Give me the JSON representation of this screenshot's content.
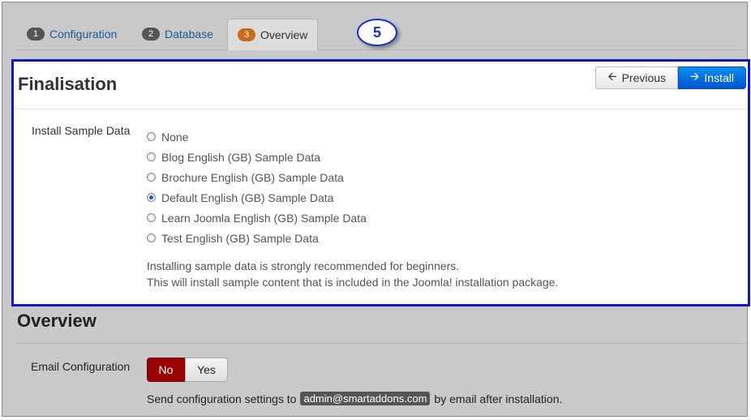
{
  "tabs": [
    {
      "num": "1",
      "label": "Configuration"
    },
    {
      "num": "2",
      "label": "Database"
    },
    {
      "num": "3",
      "label": "Overview"
    }
  ],
  "callout": "5",
  "finalisation": {
    "title": "Finalisation",
    "previous_label": "Previous",
    "install_label": "Install",
    "sample_label": "Install Sample Data",
    "options": [
      "None",
      "Blog English (GB) Sample Data",
      "Brochure English (GB) Sample Data",
      "Default English (GB) Sample Data",
      "Learn Joomla English (GB) Sample Data",
      "Test English (GB) Sample Data"
    ],
    "selected": "Default English (GB) Sample Data",
    "help_line1": "Installing sample data is strongly recommended for beginners.",
    "help_line2": "This will install sample content that is included in the Joomla! installation package."
  },
  "overview": {
    "title": "Overview",
    "email_label": "Email Configuration",
    "no_label": "No",
    "yes_label": "Yes",
    "send_prefix": "Send configuration settings to",
    "email": "admin@smartaddons.com",
    "send_suffix": "by email after installation."
  },
  "colors": {
    "accent_blue": "#0055cc",
    "highlight_border": "#1414c8",
    "no_active": "#990000",
    "active_tab_badge": "#c86a1a"
  }
}
